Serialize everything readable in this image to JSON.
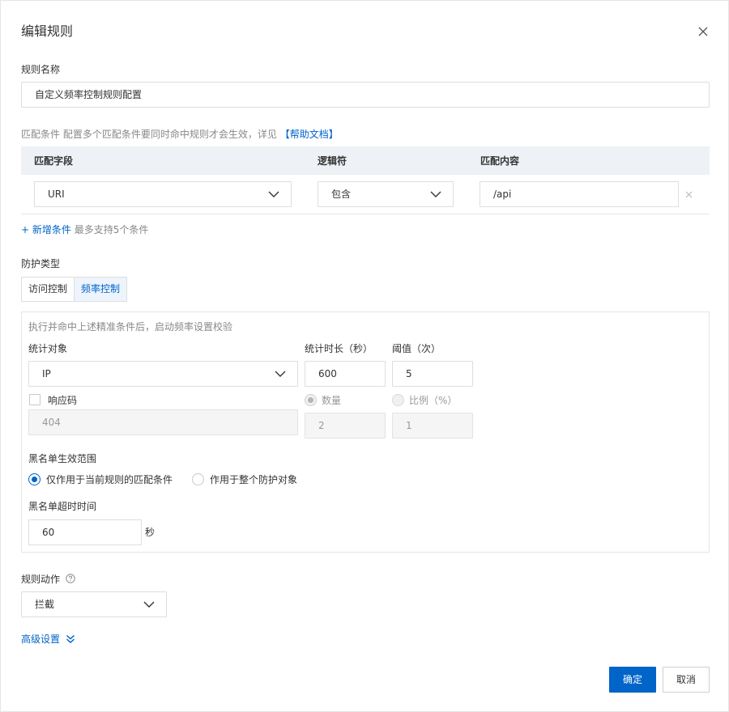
{
  "dialog": {
    "title": "编辑规则",
    "close_icon": "close-icon"
  },
  "rule_name": {
    "label": "规则名称",
    "value": "自定义频率控制规则配置"
  },
  "match": {
    "label": "匹配条件",
    "description": "配置多个匹配条件要同时命中规则才会生效，详见",
    "help_link": "【帮助文档】",
    "columns": [
      "匹配字段",
      "逻辑符",
      "匹配内容"
    ],
    "row": {
      "field": "URI",
      "operator": "包含",
      "content": "/api"
    },
    "add_link": "+ 新增条件",
    "add_hint": "最多支持5个条件"
  },
  "protection": {
    "label": "防护类型",
    "tabs": [
      {
        "label": "访问控制",
        "active": false
      },
      {
        "label": "频率控制",
        "active": true
      }
    ]
  },
  "panel": {
    "description": "执行并命中上述精准条件后，启动频率设置校验",
    "stat_target_label": "统计对象",
    "stat_target_value": "IP",
    "duration_label": "统计时长（秒）",
    "duration_value": "600",
    "threshold_label": "阈值（次）",
    "threshold_value": "5",
    "response_code_label": "响应码",
    "response_code_value": "404",
    "count_label": "数量",
    "count_value": "2",
    "ratio_label": "比例（%）",
    "ratio_value": "1",
    "scope_label": "黑名单生效范围",
    "scope_option1": "仅作用于当前规则的匹配条件",
    "scope_option2": "作用于整个防护对象",
    "timeout_label": "黑名单超时时间",
    "timeout_value": "60",
    "timeout_unit": "秒"
  },
  "action": {
    "label": "规则动作",
    "value": "拦截"
  },
  "advanced": {
    "label": "高级设置"
  },
  "footer": {
    "ok": "确定",
    "cancel": "取消"
  },
  "colors": {
    "primary": "#0064c8",
    "table_header": "#eef1f6"
  }
}
